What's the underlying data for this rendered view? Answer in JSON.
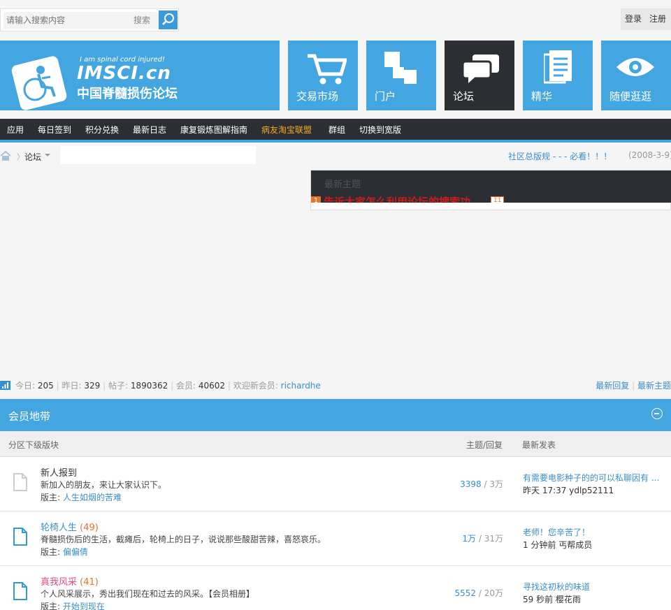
{
  "search": {
    "placeholder": "请输入搜索内容",
    "type_label": "搜索"
  },
  "user_links": {
    "login": "登录",
    "register": "注册"
  },
  "logo": {
    "tagline": "I am spinal cord injured!",
    "brand": "IMSCI.cn",
    "site_name": "中国脊髓损伤论坛"
  },
  "tiles": [
    {
      "label": "交易市场",
      "icon": "cart-icon"
    },
    {
      "label": "门户",
      "icon": "blocks-icon"
    },
    {
      "label": "论坛",
      "icon": "chat-icon",
      "active": true
    },
    {
      "label": "精华",
      "icon": "document-icon"
    },
    {
      "label": "随便逛逛",
      "icon": "eye-icon"
    }
  ],
  "nav": [
    "应用",
    "每日签到",
    "积分兑换",
    "最新日志",
    "康复锻炼图解指南",
    "病友淘宝联盟",
    "群组",
    "切换到宽版"
  ],
  "nav_highlight": "病友淘宝联盟",
  "breadcrumb": {
    "current": "论坛"
  },
  "notice": {
    "text": "社区总版规 - - - 必看！！！",
    "date": "(2008-3-9)"
  },
  "widget": {
    "title": "最新主题",
    "rank": "1",
    "topic": "告诉大家怎么利用论坛的搜索功",
    "count": "11"
  },
  "stats": {
    "today_label": "今日:",
    "today": "205",
    "yesterday_label": "昨日:",
    "yesterday": "329",
    "posts_label": "帖子:",
    "posts": "1890362",
    "members_label": "会员:",
    "members": "40602",
    "new_member_label": "欢迎新会员:",
    "new_member": "richardhe",
    "latest_reply": "最新回复",
    "latest_topic": "最新主题"
  },
  "category": {
    "title": "会员地带",
    "col_forum": "分区下级版块",
    "col_counts": "主题/回复",
    "col_last": "最新发表",
    "forums": [
      {
        "name": "新人报到",
        "new_count": "",
        "desc": "新加入的朋友，来让大家认识下。",
        "mod_label": "版主:",
        "moderator": "人生如烟的苦难",
        "topics": "3398",
        "replies": "3万",
        "last_title": "有需要电影种子的的可以私聊因有 ...",
        "last_time": "昨天 17:37",
        "last_user": "ydlp52111",
        "style": "plain"
      },
      {
        "name": "轮椅人生",
        "new_count": "(49)",
        "desc": "脊髓损伤后的生活，截瘫后，轮椅上的日子，说说那些酸甜苦辣，喜怒哀乐。",
        "mod_label": "版主:",
        "moderator": "偏偏倩",
        "topics": "1万",
        "replies": "31万",
        "last_title": "老师！您辛苦了！",
        "last_time": "1 分钟前",
        "last_user": "丐帮成员",
        "style": "blue"
      },
      {
        "name": "真我风采",
        "new_count": "(41)",
        "desc": "个人风采展示，秀出我们现在和过去的风采。【会员相册】",
        "mod_label": "版主:",
        "moderator": "开始到现在",
        "topics": "5552",
        "replies": "20万",
        "last_title": "寻找这初秋的味道",
        "last_time": "59 秒前",
        "last_user": "樱花雨",
        "style": "pink"
      }
    ]
  },
  "colors": {
    "accent": "#43a6e0",
    "dark": "#2b2f33",
    "link": "#3a8ec9",
    "highlight": "#f7a823",
    "new": "#e8732b"
  }
}
